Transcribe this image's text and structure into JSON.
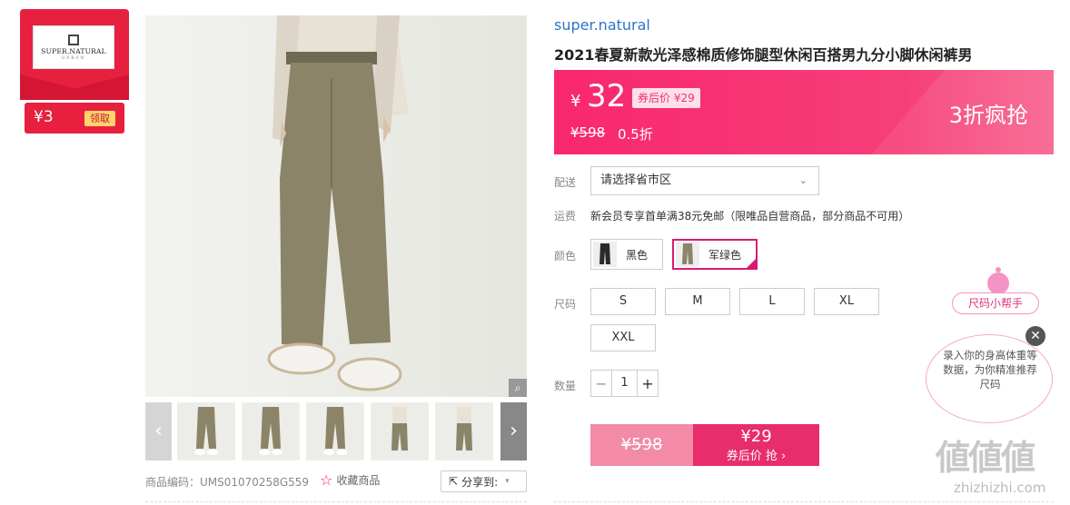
{
  "brand_card": {
    "logo_line1": "SUPER.NATURAL",
    "logo_line2": "URBAN",
    "coupon_amount": "¥3",
    "claim_label": "领取"
  },
  "gallery": {
    "zoom_icon": "magnifier-icon",
    "prev_icon": "chevron-left-icon",
    "next_icon": "chevron-right-icon",
    "thumbnails": [
      "thumb-1",
      "thumb-2",
      "thumb-3",
      "thumb-4",
      "thumb-5"
    ]
  },
  "footer": {
    "sku": "商品编码：UMS01070258G559",
    "favorite_label": "收藏商品",
    "share_label": "分享到:"
  },
  "product": {
    "brand": "super.natural",
    "title": "2021春夏新款光泽感棉质修饰腿型休闲百搭男九分小脚休闲裤男"
  },
  "price": {
    "currency": "¥",
    "current": "32",
    "coupon_price": "券后价 ¥29",
    "original": "¥598",
    "discount": "0.5折",
    "promo": "3折疯抢"
  },
  "delivery": {
    "label": "配送",
    "placeholder": "请选择省市区",
    "shipping_label": "运费",
    "shipping_text": "新会员专享首单满38元免邮（限唯品自营商品，部分商品不可用）"
  },
  "color": {
    "label": "颜色",
    "options": [
      "黑色",
      "军绿色"
    ],
    "selected": "军绿色"
  },
  "size": {
    "label": "尺码",
    "options": [
      "S",
      "M",
      "L",
      "XL",
      "XXL"
    ]
  },
  "quantity": {
    "label": "数量",
    "value": "1",
    "dec": "−",
    "inc": "+"
  },
  "buy": {
    "original": "¥598",
    "price": "¥29",
    "action": "券后价 抢 ›"
  },
  "size_helper": {
    "button": "尺码小帮手",
    "bubble": "录入你的身高体重等数据，为你精准推荐尺码",
    "close": "✕"
  },
  "watermark": {
    "logo": "値値値",
    "url": "zhizhizhi.com"
  }
}
